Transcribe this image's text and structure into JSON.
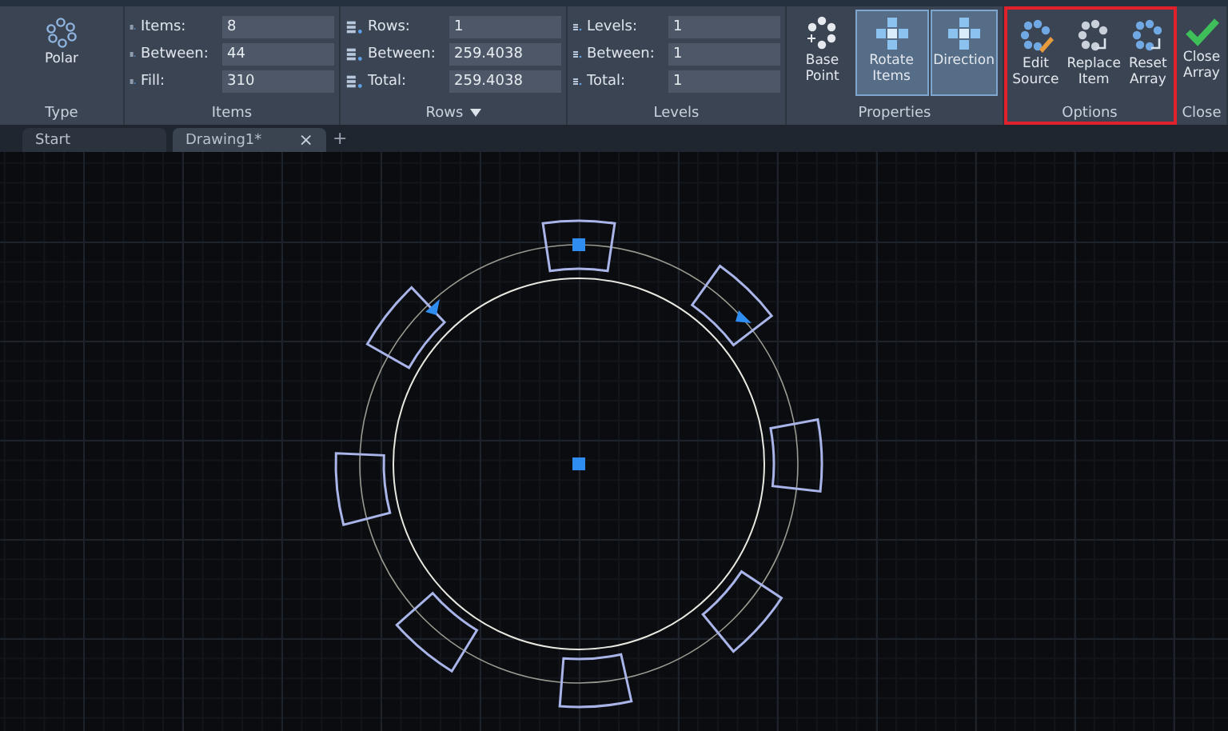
{
  "ribbon": {
    "panels": [
      {
        "kind": "type",
        "title": "Type",
        "button": {
          "label": "Polar"
        }
      },
      {
        "kind": "fields",
        "title": "Items",
        "dropdown": false,
        "fields": [
          {
            "label": "Items:",
            "value": "8"
          },
          {
            "label": "Between:",
            "value": "44"
          },
          {
            "label": "Fill:",
            "value": "310"
          }
        ]
      },
      {
        "kind": "fields",
        "title": "Rows",
        "dropdown": true,
        "fields": [
          {
            "label": "Rows:",
            "value": "1"
          },
          {
            "label": "Between:",
            "value": "259.4038"
          },
          {
            "label": "Total:",
            "value": "259.4038"
          }
        ]
      },
      {
        "kind": "fields",
        "title": "Levels",
        "dropdown": false,
        "fields": [
          {
            "label": "Levels:",
            "value": "1"
          },
          {
            "label": "Between:",
            "value": "1"
          },
          {
            "label": "Total:",
            "value": "1"
          }
        ]
      },
      {
        "kind": "buttons",
        "title": "Properties",
        "highlighted": false,
        "buttons": [
          {
            "label": "Base Point",
            "selected": false
          },
          {
            "label": "Rotate Items",
            "selected": true
          },
          {
            "label": "Direction",
            "selected": true
          }
        ]
      },
      {
        "kind": "buttons",
        "title": "Options",
        "highlighted": true,
        "buttons": [
          {
            "label": "Edit Source",
            "selected": false
          },
          {
            "label": "Replace Item",
            "selected": false
          },
          {
            "label": "Reset Array",
            "selected": false
          }
        ]
      },
      {
        "kind": "buttons",
        "title": "Close",
        "highlighted": false,
        "buttons": [
          {
            "label": "Close Array",
            "selected": false
          }
        ]
      }
    ]
  },
  "tabs": [
    {
      "label": "Start",
      "selected": false,
      "closable": false
    },
    {
      "label": "Drawing1*",
      "selected": true,
      "closable": true
    }
  ],
  "close_glyph": "×",
  "new_tab_glyph": "+"
}
